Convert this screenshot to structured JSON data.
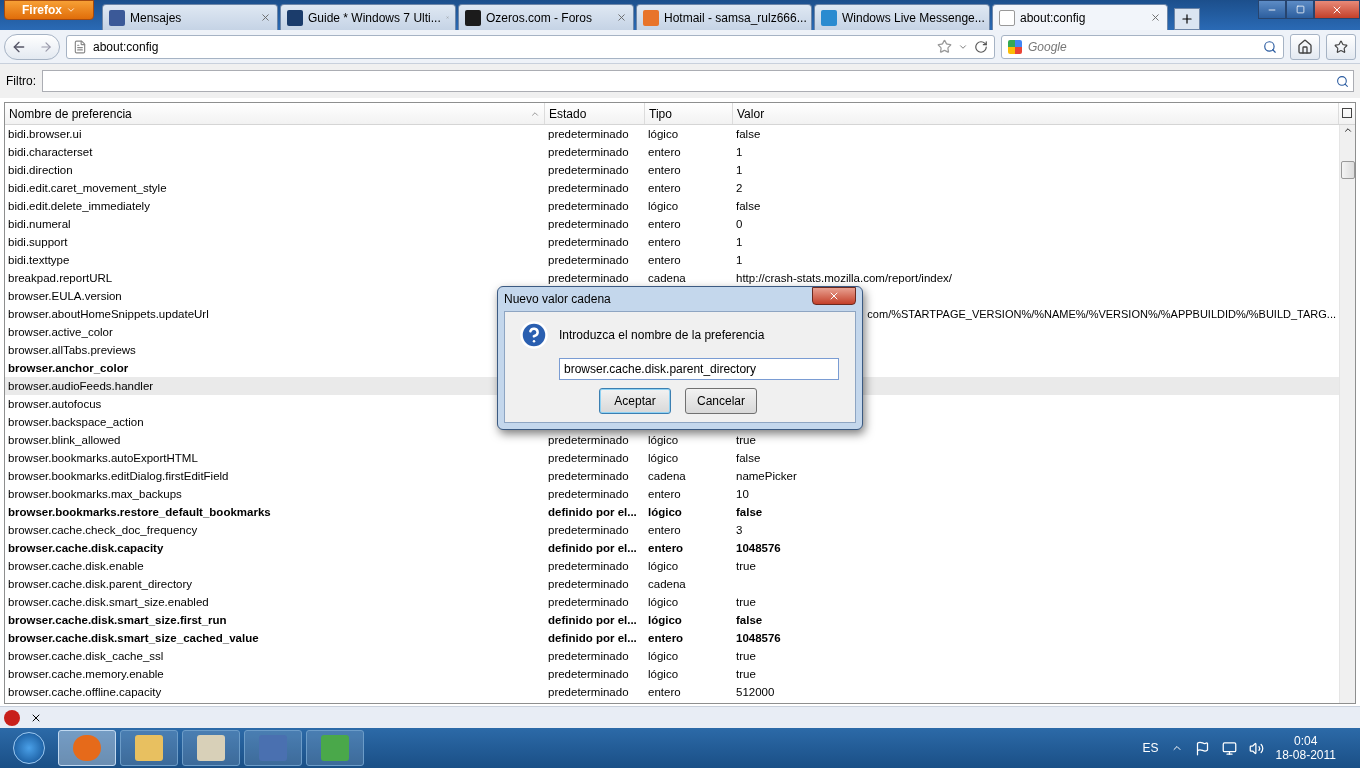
{
  "app_button": "Firefox",
  "tabs": [
    {
      "title": "Mensajes",
      "selected": false
    },
    {
      "title": "Guide * Windows 7 Ulti...",
      "selected": false
    },
    {
      "title": "Ozeros.com - Foros",
      "selected": false
    },
    {
      "title": "Hotmail - samsa_rulz666...",
      "selected": false
    },
    {
      "title": "Windows Live Messenge...",
      "selected": false
    },
    {
      "title": "about:config",
      "selected": true
    }
  ],
  "address": "about:config",
  "search": {
    "placeholder": "Google"
  },
  "filter": {
    "label": "Filtro:"
  },
  "table": {
    "columns": [
      "Nombre de preferencia",
      "Estado",
      "Tipo",
      "Valor"
    ],
    "rows": [
      {
        "name": "bidi.browser.ui",
        "state": "predeterminado",
        "type": "lógico",
        "value": "false",
        "modified": false,
        "selected": false
      },
      {
        "name": "bidi.characterset",
        "state": "predeterminado",
        "type": "entero",
        "value": "1",
        "modified": false,
        "selected": false
      },
      {
        "name": "bidi.direction",
        "state": "predeterminado",
        "type": "entero",
        "value": "1",
        "modified": false,
        "selected": false
      },
      {
        "name": "bidi.edit.caret_movement_style",
        "state": "predeterminado",
        "type": "entero",
        "value": "2",
        "modified": false,
        "selected": false
      },
      {
        "name": "bidi.edit.delete_immediately",
        "state": "predeterminado",
        "type": "lógico",
        "value": "false",
        "modified": false,
        "selected": false
      },
      {
        "name": "bidi.numeral",
        "state": "predeterminado",
        "type": "entero",
        "value": "0",
        "modified": false,
        "selected": false
      },
      {
        "name": "bidi.support",
        "state": "predeterminado",
        "type": "entero",
        "value": "1",
        "modified": false,
        "selected": false
      },
      {
        "name": "bidi.texttype",
        "state": "predeterminado",
        "type": "entero",
        "value": "1",
        "modified": false,
        "selected": false
      },
      {
        "name": "breakpad.reportURL",
        "state": "predeterminado",
        "type": "cadena",
        "value": "http://crash-stats.mozilla.com/report/index/",
        "modified": false,
        "selected": false
      },
      {
        "name": "browser.EULA.version",
        "modified": false,
        "selected": false
      },
      {
        "name": "browser.aboutHomeSnippets.updateUrl",
        "value": "com/%STARTPAGE_VERSION%/%NAME%/%VERSION%/%APPBUILDID%/%BUILD_TARG...",
        "kind": "cut",
        "modified": false,
        "selected": false
      },
      {
        "name": "browser.active_color",
        "modified": false,
        "selected": false
      },
      {
        "name": "browser.allTabs.previews",
        "modified": false,
        "selected": false
      },
      {
        "name": "browser.anchor_color",
        "modified": true,
        "selected": false
      },
      {
        "name": "browser.audioFeeds.handler",
        "modified": false,
        "selected": true
      },
      {
        "name": "browser.autofocus",
        "modified": false,
        "selected": false
      },
      {
        "name": "browser.backspace_action",
        "modified": false,
        "selected": false
      },
      {
        "name": "browser.blink_allowed",
        "state": "predeterminado",
        "type": "lógico",
        "value": "true",
        "modified": false,
        "selected": false
      },
      {
        "name": "browser.bookmarks.autoExportHTML",
        "state": "predeterminado",
        "type": "lógico",
        "value": "false",
        "modified": false,
        "selected": false
      },
      {
        "name": "browser.bookmarks.editDialog.firstEditField",
        "state": "predeterminado",
        "type": "cadena",
        "value": "namePicker",
        "modified": false,
        "selected": false
      },
      {
        "name": "browser.bookmarks.max_backups",
        "state": "predeterminado",
        "type": "entero",
        "value": "10",
        "modified": false,
        "selected": false
      },
      {
        "name": "browser.bookmarks.restore_default_bookmarks",
        "state": "definido por el...",
        "type": "lógico",
        "value": "false",
        "modified": true,
        "selected": false
      },
      {
        "name": "browser.cache.check_doc_frequency",
        "state": "predeterminado",
        "type": "entero",
        "value": "3",
        "modified": false,
        "selected": false
      },
      {
        "name": "browser.cache.disk.capacity",
        "state": "definido por el...",
        "type": "entero",
        "value": "1048576",
        "modified": true,
        "selected": false
      },
      {
        "name": "browser.cache.disk.enable",
        "state": "predeterminado",
        "type": "lógico",
        "value": "true",
        "modified": false,
        "selected": false
      },
      {
        "name": "browser.cache.disk.parent_directory",
        "state": "predeterminado",
        "type": "cadena",
        "modified": false,
        "selected": false
      },
      {
        "name": "browser.cache.disk.smart_size.enabled",
        "state": "predeterminado",
        "type": "lógico",
        "value": "true",
        "modified": false,
        "selected": false
      },
      {
        "name": "browser.cache.disk.smart_size.first_run",
        "state": "definido por el...",
        "type": "lógico",
        "value": "false",
        "modified": true,
        "selected": false
      },
      {
        "name": "browser.cache.disk.smart_size_cached_value",
        "state": "definido por el...",
        "type": "entero",
        "value": "1048576",
        "modified": true,
        "selected": false
      },
      {
        "name": "browser.cache.disk_cache_ssl",
        "state": "predeterminado",
        "type": "lógico",
        "value": "true",
        "modified": false,
        "selected": false
      },
      {
        "name": "browser.cache.memory.enable",
        "state": "predeterminado",
        "type": "lógico",
        "value": "true",
        "modified": false,
        "selected": false
      },
      {
        "name": "browser.cache.offline.capacity",
        "state": "predeterminado",
        "type": "entero",
        "value": "512000",
        "modified": false,
        "selected": false
      }
    ]
  },
  "dialog": {
    "title": "Nuevo valor cadena",
    "message": "Introduzca el nombre de la preferencia",
    "value": "browser.cache.disk.parent_directory",
    "buttons": [
      {
        "label": "Aceptar",
        "selected": true
      },
      {
        "label": "Cancelar",
        "selected": false
      }
    ]
  },
  "taskbar": {
    "apps": [
      {
        "kind": "firefox",
        "active": true
      },
      {
        "kind": "folder",
        "active": false
      },
      {
        "kind": "paint",
        "active": false
      },
      {
        "kind": "computer",
        "active": false
      },
      {
        "kind": "windows",
        "active": false
      }
    ],
    "language": "ES",
    "time": "0:04",
    "date": "18-08-2011"
  }
}
